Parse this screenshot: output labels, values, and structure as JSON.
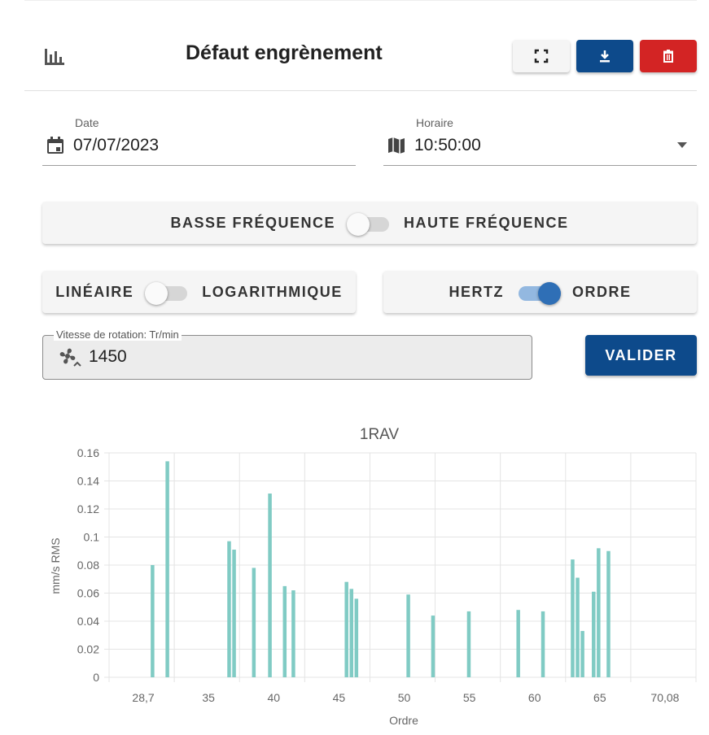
{
  "header": {
    "title": "Défaut engrènement",
    "icons": {
      "chart": "bar-chart-icon",
      "fullscreen": "fullscreen-icon",
      "download": "download-icon",
      "delete": "trash-icon"
    },
    "colors": {
      "download": "#0d4a8b",
      "delete": "#d32424"
    }
  },
  "date_field": {
    "label": "Date",
    "value": "07/07/2023",
    "icon": "calendar-icon"
  },
  "time_field": {
    "label": "Horaire",
    "value": "10:50:00",
    "icon": "map-icon"
  },
  "frequency_toggle": {
    "left_label": "BASSE FRÉQUENCE",
    "right_label": "HAUTE FRÉQUENCE",
    "state": "left"
  },
  "scale_toggle": {
    "left_label": "LINÉAIRE",
    "right_label": "LOGARITHMIQUE",
    "state": "left"
  },
  "unit_toggle": {
    "left_label": "HERTZ",
    "right_label": "ORDRE",
    "state": "right"
  },
  "speed": {
    "label": "Vitesse de rotation: Tr/min",
    "value": "1450",
    "icon": "fan-icon"
  },
  "validate_button": "VALIDER",
  "chart_data": {
    "type": "bar",
    "title": "1RAV",
    "xlabel": "Ordre",
    "ylabel": "mm/s RMS",
    "xlim": [
      25.8,
      73.3
    ],
    "ylim": [
      0,
      0.16
    ],
    "x_tick_labels": [
      "28,7",
      "35",
      "40",
      "45",
      "50",
      "55",
      "60",
      "65",
      "70,08"
    ],
    "y_tick_labels": [
      "0",
      "0.02",
      "0.04",
      "0.06",
      "0.08",
      "0.1",
      "0.12",
      "0.14",
      "0.16"
    ],
    "grid": true,
    "color": "#80cbc4",
    "points": [
      {
        "x": 29.3,
        "y": 0.08
      },
      {
        "x": 30.5,
        "y": 0.154
      },
      {
        "x": 35.5,
        "y": 0.097
      },
      {
        "x": 35.9,
        "y": 0.091
      },
      {
        "x": 37.5,
        "y": 0.078
      },
      {
        "x": 38.8,
        "y": 0.131
      },
      {
        "x": 40.0,
        "y": 0.065
      },
      {
        "x": 40.7,
        "y": 0.062
      },
      {
        "x": 45.0,
        "y": 0.068
      },
      {
        "x": 45.4,
        "y": 0.063
      },
      {
        "x": 45.8,
        "y": 0.056
      },
      {
        "x": 50.0,
        "y": 0.059
      },
      {
        "x": 52.0,
        "y": 0.044
      },
      {
        "x": 54.9,
        "y": 0.047
      },
      {
        "x": 58.9,
        "y": 0.048
      },
      {
        "x": 60.9,
        "y": 0.047
      },
      {
        "x": 63.3,
        "y": 0.084
      },
      {
        "x": 63.7,
        "y": 0.071
      },
      {
        "x": 64.1,
        "y": 0.033
      },
      {
        "x": 65.0,
        "y": 0.061
      },
      {
        "x": 65.4,
        "y": 0.092
      },
      {
        "x": 66.2,
        "y": 0.09
      }
    ]
  }
}
